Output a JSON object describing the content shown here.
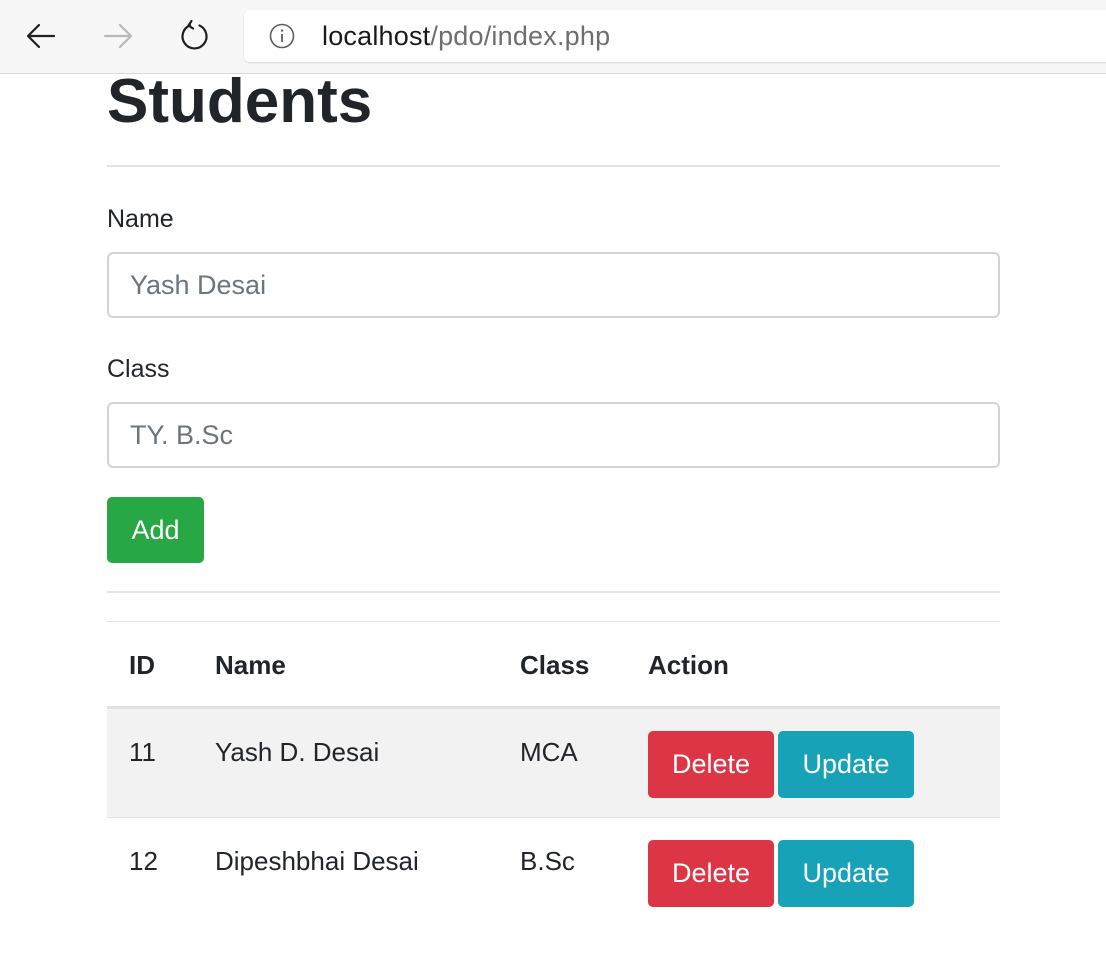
{
  "browser": {
    "url_host": "localhost",
    "url_path": "/pdo/index.php"
  },
  "page": {
    "title": "Students"
  },
  "form": {
    "name_label": "Name",
    "name_placeholder": "Yash Desai",
    "class_label": "Class",
    "class_placeholder": "TY. B.Sc",
    "add_label": "Add"
  },
  "table": {
    "headers": [
      "ID",
      "Name",
      "Class",
      "Action"
    ],
    "rows": [
      {
        "id": "11",
        "name": "Yash D. Desai",
        "class": "MCA",
        "delete_label": "Delete",
        "update_label": "Update"
      },
      {
        "id": "12",
        "name": "Dipeshbhai Desai",
        "class": "B.Sc",
        "delete_label": "Delete",
        "update_label": "Update"
      }
    ]
  },
  "colors": {
    "success": "#28a745",
    "danger": "#dc3545",
    "info": "#17a2b8"
  }
}
